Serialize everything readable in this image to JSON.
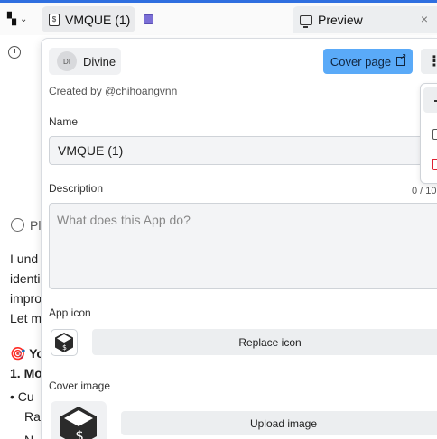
{
  "topbar": {
    "app_tab_label": "VMQUE (1)",
    "preview_tab_label": "Preview",
    "close_glyph": "×"
  },
  "background": {
    "lines": [
      "Pl",
      "I und",
      "identi",
      "impro",
      "Let m",
      "🎯 Yo",
      "1. Mo",
      "• Cu",
      "Rar",
      "N"
    ]
  },
  "panel": {
    "owner": {
      "avatar_initials": "DI",
      "name": "Divine"
    },
    "cover_page_label": "Cover page",
    "more_glyph": "⋮",
    "created_by": "Created by @chihoangvnn",
    "name_label": "Name",
    "name_value": "VMQUE (1)",
    "description_label": "Description",
    "description_counter": "0 / 10",
    "description_placeholder": "What does this App do?",
    "app_icon_label": "App icon",
    "replace_icon_label": "Replace icon",
    "cover_image_label": "Cover image",
    "upload_image_label": "Upload image"
  },
  "colors": {
    "accent": "#2f6fe0",
    "cover_button": "#5aaaf8",
    "delete_icon": "#dd2233"
  }
}
